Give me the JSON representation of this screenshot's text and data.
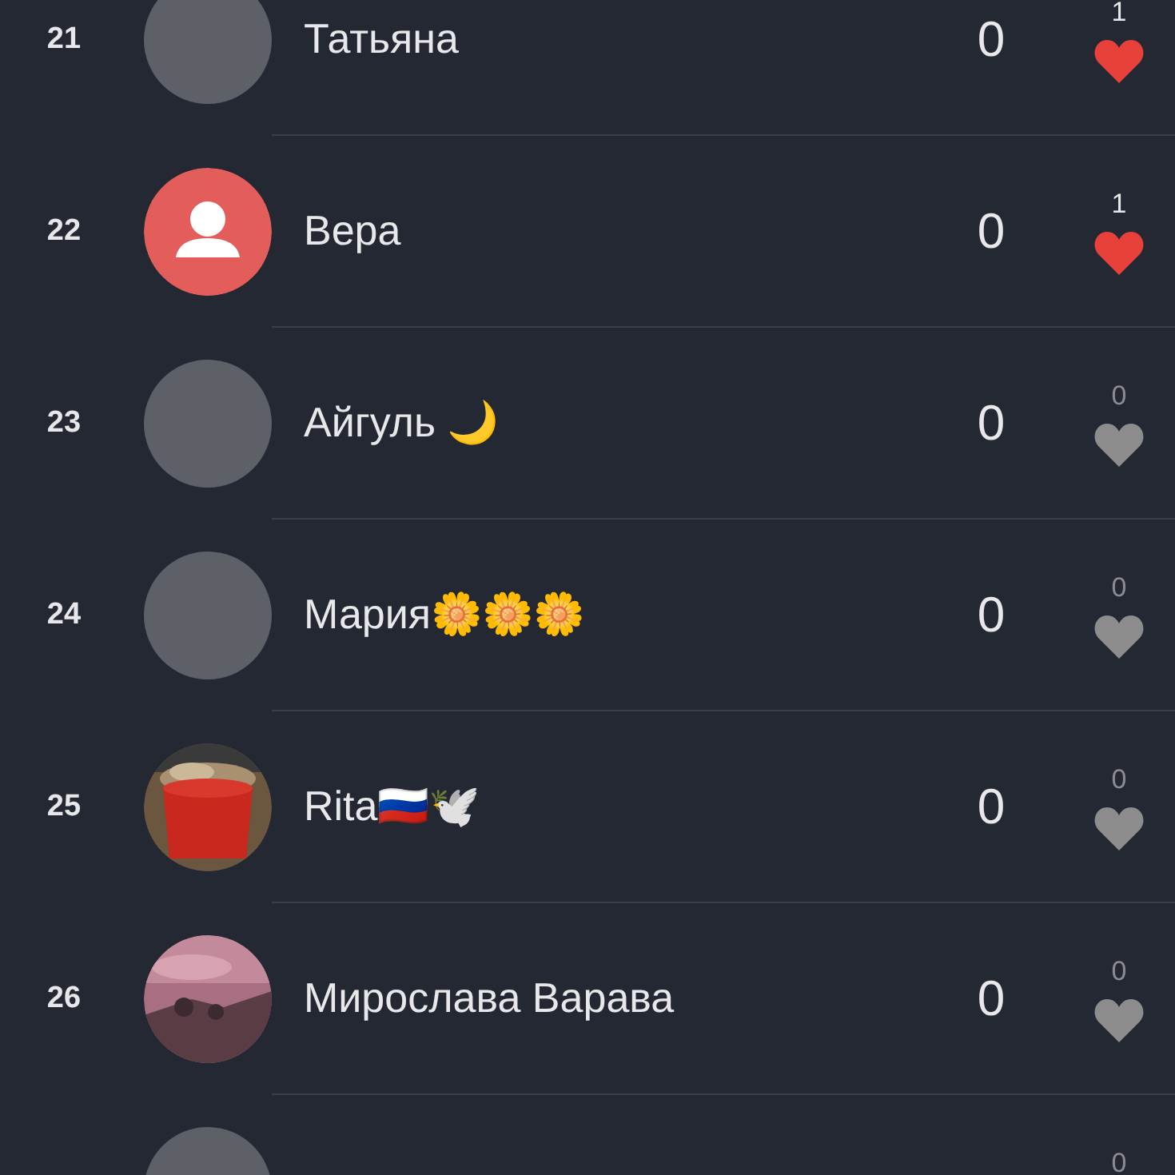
{
  "rows": [
    {
      "rank": "21",
      "avatar": {
        "kind": "blank"
      },
      "name": "Татьяна",
      "score": "0",
      "likes": "1",
      "liked": true
    },
    {
      "rank": "22",
      "avatar": {
        "kind": "person"
      },
      "name": "Вера",
      "score": "0",
      "likes": "1",
      "liked": true
    },
    {
      "rank": "23",
      "avatar": {
        "kind": "blank"
      },
      "name": "Айгуль 🌙",
      "score": "0",
      "likes": "0",
      "liked": false
    },
    {
      "rank": "24",
      "avatar": {
        "kind": "blank"
      },
      "name": "Мария🌼🌼🌼",
      "score": "0",
      "likes": "0",
      "liked": false
    },
    {
      "rank": "25",
      "name": "Rita🇷🇺🕊️",
      "score": "0",
      "likes": "0",
      "liked": false
    },
    {
      "rank": "26",
      "name": "Мирослава Варава",
      "score": "0",
      "likes": "0",
      "liked": false
    },
    {
      "avatar": {
        "kind": "blank"
      },
      "likes": "0"
    }
  ]
}
